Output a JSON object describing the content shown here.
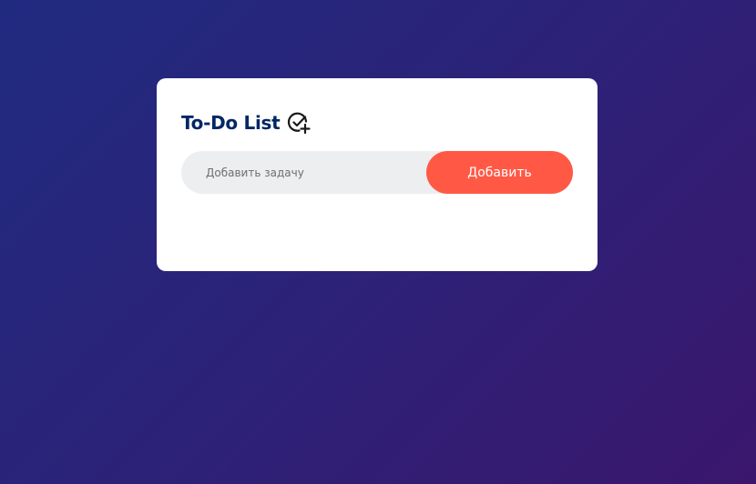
{
  "app": {
    "title": "To-Do List",
    "title_icon": "check-circle-plus-icon"
  },
  "task_form": {
    "input_value": "",
    "input_placeholder": "Добавить задачу",
    "add_button_label": "Добавить"
  },
  "colors": {
    "background_start": "#202b80",
    "background_end": "#3a176d",
    "card": "#ffffff",
    "title": "#002765",
    "input_background": "#edeef0",
    "accent": "#ff5945"
  },
  "tasks": []
}
